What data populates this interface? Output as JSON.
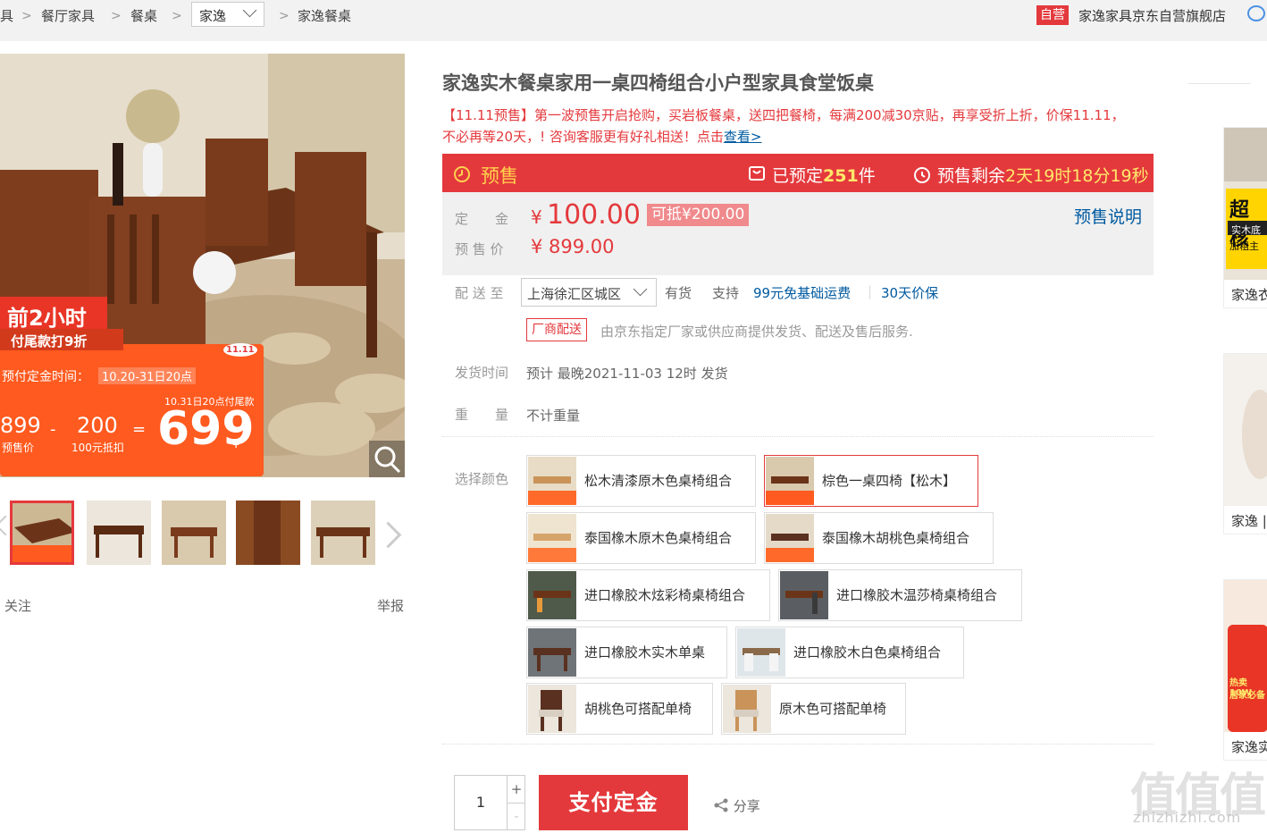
{
  "breadcrumb": {
    "items": [
      "具",
      "餐厅家具",
      "餐桌"
    ],
    "brand_select": "家逸",
    "current": "家逸餐桌",
    "self_operated_badge": "自营",
    "store_name": "家逸家具京东自营旗舰店"
  },
  "gallery": {
    "promo_overlay": {
      "line1": "前2小时",
      "line2": "付尾款打9折",
      "deposit_time_label": "预付定金时间：",
      "deposit_time_value": "10.20-31日20点",
      "final_pay_note": "10.31日20点付尾款",
      "presale_price": "899",
      "presale_price_label": "预售价",
      "deduct": "200",
      "deduct_label": "100元抵扣",
      "final_price": "699",
      "final_price_currency": "¥",
      "badge": "11.11"
    },
    "follow_label": "关注",
    "report_label": "举报"
  },
  "product": {
    "title": "家逸实木餐桌家用一桌四椅组合小户型家具食堂饭桌",
    "promo_text": "【11.11预售】第一波预售开启抢购，买岩板餐桌，送四把餐椅，每满200减30京贴，再享受折上折，价保11.11，不必再等20天，! 咨询客服更有好礼相送！点击",
    "promo_link": "查看>"
  },
  "presale": {
    "label": "预售",
    "reserved_prefix": "已预定",
    "reserved_count": "251",
    "reserved_suffix": "件",
    "remaining_label": "预售剩余",
    "remaining_time": "2天19时18分19秒"
  },
  "price": {
    "deposit_label": "定　　金",
    "deposit_currency": "¥",
    "deposit_value": "100.00",
    "deduct_badge": "可抵¥200.00",
    "presale_label": "预 售 价",
    "presale_value": "¥ 899.00",
    "explain_link": "预售说明"
  },
  "delivery": {
    "label": "配 送 至",
    "region": "上海徐汇区城区",
    "stock": "有货",
    "support_label": "支持",
    "freight": "99元免基础运费",
    "price_protect": "30天价保",
    "vendor_tag": "厂商配送",
    "vendor_note": "由京东指定厂家或供应商提供发货、配送及售后服务."
  },
  "ship_time": {
    "label": "发货时间",
    "value": "预计 最晚2021-11-03 12时 发货"
  },
  "weight": {
    "label": "重　　量",
    "value": "不计重量"
  },
  "color": {
    "label": "选择颜色",
    "options": [
      "松木清漆原木色桌椅组合",
      "棕色一桌四椅【松木】",
      "泰国橡木原木色桌椅组合",
      "泰国橡木胡桃色桌椅组合",
      "进口橡胶木炫彩椅桌椅组合",
      "进口橡胶木温莎椅桌椅组合",
      "进口橡胶木实木单桌",
      "进口橡胶木白色桌椅组合",
      "胡桃色可搭配单椅",
      "原木色可搭配单椅"
    ],
    "selected_index": 1
  },
  "buy": {
    "quantity": "1",
    "plus": "+",
    "minus": "-",
    "pay_button": "支付定金",
    "share_label": "分享"
  },
  "rail": {
    "items": [
      "家逸衣",
      "家逸 |",
      "家逸实"
    ],
    "banner_text_1": "超核",
    "banner_text_2": "实木底",
    "banner_text_3": "加粗主",
    "banner_text_4": "热卖10W",
    "banner_text_5": "居家必备"
  },
  "watermark": {
    "text": "值值值",
    "url": "zhizhizhi.com"
  },
  "colors": {
    "accent": "#e4393c",
    "link": "#005aa0",
    "presale_time": "#ffe86b"
  }
}
